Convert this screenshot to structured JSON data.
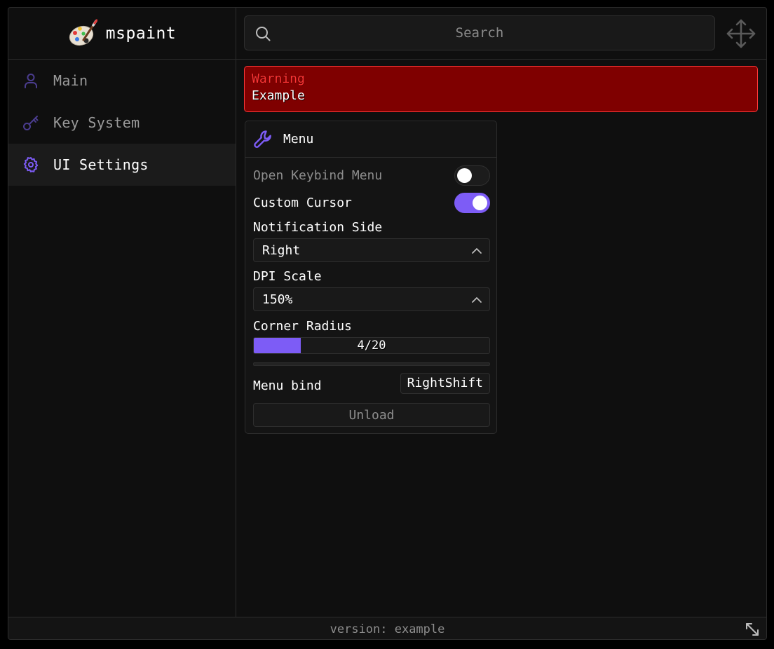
{
  "brand": {
    "name": "mspaint",
    "icon": "paint-palette-icon"
  },
  "search": {
    "placeholder": "Search"
  },
  "sidebar": {
    "items": [
      {
        "label": "Main",
        "icon": "user-icon",
        "active": false
      },
      {
        "label": "Key System",
        "icon": "key-icon",
        "active": false
      },
      {
        "label": "UI Settings",
        "icon": "gear-icon",
        "active": true
      }
    ]
  },
  "alert": {
    "title": "Warning",
    "body": "Example"
  },
  "group": {
    "title": "Menu",
    "icon": "wrench-icon",
    "open_keybind_menu": {
      "label": "Open Keybind Menu",
      "on": false
    },
    "custom_cursor": {
      "label": "Custom Cursor",
      "on": true
    },
    "notification_side": {
      "label": "Notification Side",
      "value": "Right"
    },
    "dpi_scale": {
      "label": "DPI Scale",
      "value": "150%"
    },
    "corner_radius": {
      "label": "Corner Radius",
      "value": 4,
      "max": 20,
      "display": "4/20"
    },
    "menu_bind": {
      "label": "Menu bind",
      "key": "RightShift"
    },
    "unload": {
      "label": "Unload"
    }
  },
  "footer": {
    "version": "version: example"
  },
  "colors": {
    "accent": "#7d5cf6",
    "alert_bg": "#7f0000",
    "alert_border": "#ff3a3a",
    "alert_title": "#ff3434",
    "background": "#0f0f0f"
  }
}
